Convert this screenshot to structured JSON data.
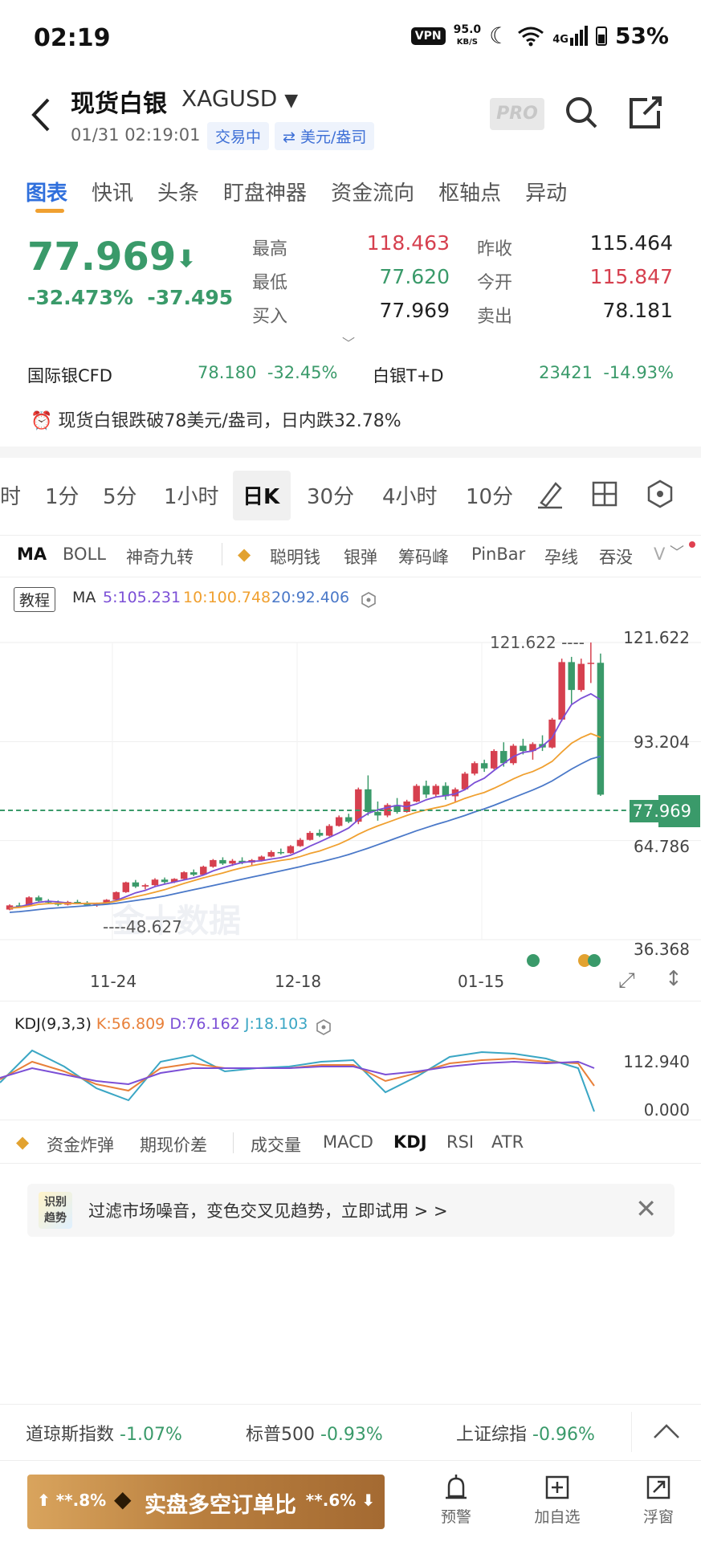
{
  "status_bar": {
    "time": "02:19",
    "vpn": "VPN",
    "speed_value": "95.0",
    "speed_unit": "KB/S",
    "network": "4G",
    "battery": "53%"
  },
  "header": {
    "title": "现货白银",
    "symbol": "XAGUSD",
    "datetime": "01/31 02:19:01",
    "trading_status": "交易中",
    "unit": "⇄ 美元/盎司",
    "pro_label": "PRO"
  },
  "tabs": [
    {
      "label": "图表",
      "active": true
    },
    {
      "label": "快讯"
    },
    {
      "label": "头条"
    },
    {
      "label": "盯盘神器"
    },
    {
      "label": "资金流向"
    },
    {
      "label": "枢轴点"
    },
    {
      "label": "异动"
    }
  ],
  "quote": {
    "price": "77.969",
    "arrow": "⬇",
    "change_pct": "-32.473%",
    "change_abs": "-37.495",
    "high_label": "最高",
    "high": "118.463",
    "low_label": "最低",
    "low": "77.620",
    "bid_label": "买入",
    "bid": "77.969",
    "prev_close_label": "昨收",
    "prev_close": "115.464",
    "open_label": "今开",
    "open": "115.847",
    "ask_label": "卖出",
    "ask": "78.181"
  },
  "related": [
    {
      "name": "国际银CFD",
      "price": "78.180",
      "change": "-32.45%"
    },
    {
      "name": "白银T+D",
      "price": "23421",
      "change": "-14.93%"
    }
  ],
  "alert_text": "现货白银跌破78美元/盎司，日内跌32.78%",
  "timeframes": [
    "时",
    "1分",
    "5分",
    "1小时",
    "日K",
    "30分",
    "4小时",
    "10分"
  ],
  "active_timeframe": "日K",
  "indicators": [
    "MA",
    "BOLL",
    "神奇九转",
    "聪明钱",
    "银弹",
    "筹码峰",
    "PinBar",
    "孕线",
    "吞没",
    "V"
  ],
  "ma_legend": {
    "tutorial": "教程",
    "label": "MA",
    "ma5": "5:105.231",
    "ma10": "10:100.748",
    "ma20": "20:92.406"
  },
  "chart_axis": {
    "y_labels": [
      "121.622",
      "93.204",
      "64.786",
      "36.368"
    ],
    "current": "77.969",
    "high_marker": "121.622 ----",
    "low_marker": "----48.627",
    "x_labels": [
      "11-24",
      "12-18",
      "01-15"
    ],
    "watermark": "金十数据"
  },
  "chart_data": {
    "type": "candlestick",
    "ylim": [
      36.368,
      121.622
    ],
    "candles": [
      [
        45.0,
        46.5,
        44.8,
        46.2
      ],
      [
        46.2,
        47.0,
        45.6,
        46.0
      ],
      [
        46.0,
        48.8,
        45.8,
        48.5
      ],
      [
        48.5,
        49.0,
        47.2,
        47.5
      ],
      [
        47.5,
        48.0,
        46.6,
        47.0
      ],
      [
        47.0,
        47.6,
        46.0,
        46.4
      ],
      [
        46.4,
        47.5,
        46.2,
        47.2
      ],
      [
        47.2,
        47.8,
        46.5,
        46.9
      ],
      [
        46.9,
        47.4,
        46.0,
        46.3
      ],
      [
        46.3,
        47.0,
        45.8,
        46.6
      ],
      [
        46.6,
        48.0,
        46.4,
        47.8
      ],
      [
        47.8,
        50.2,
        47.5,
        50.0
      ],
      [
        50.0,
        53.0,
        49.8,
        52.8
      ],
      [
        52.8,
        53.5,
        51.2,
        51.6
      ],
      [
        51.6,
        52.4,
        50.8,
        52.0
      ],
      [
        52.0,
        54.0,
        51.8,
        53.6
      ],
      [
        53.6,
        54.2,
        52.5,
        52.9
      ],
      [
        52.9,
        54.0,
        52.6,
        53.8
      ],
      [
        53.8,
        56.0,
        53.5,
        55.7
      ],
      [
        55.7,
        56.5,
        54.6,
        55.0
      ],
      [
        55.0,
        57.6,
        54.8,
        57.3
      ],
      [
        57.3,
        59.5,
        57.0,
        59.2
      ],
      [
        59.2,
        60.0,
        57.8,
        58.2
      ],
      [
        58.2,
        59.5,
        57.5,
        59.0
      ],
      [
        59.0,
        60.0,
        58.0,
        58.5
      ],
      [
        58.5,
        59.5,
        57.8,
        59.2
      ],
      [
        59.2,
        60.5,
        58.8,
        60.2
      ],
      [
        60.2,
        62.0,
        60.0,
        61.5
      ],
      [
        61.5,
        62.5,
        60.8,
        61.2
      ],
      [
        61.2,
        63.5,
        61.0,
        63.2
      ],
      [
        63.2,
        65.5,
        63.0,
        65.0
      ],
      [
        65.0,
        67.5,
        64.8,
        67.0
      ],
      [
        67.0,
        68.0,
        65.8,
        66.2
      ],
      [
        66.2,
        69.5,
        66.0,
        69.0
      ],
      [
        69.0,
        72.0,
        68.8,
        71.5
      ],
      [
        71.5,
        72.5,
        69.8,
        70.2
      ],
      [
        70.2,
        80.0,
        69.5,
        79.5
      ],
      [
        79.5,
        83.5,
        72.0,
        73.0
      ],
      [
        73.0,
        76.0,
        70.5,
        72.0
      ],
      [
        72.0,
        75.5,
        71.5,
        75.0
      ],
      [
        75.0,
        77.0,
        72.5,
        73.0
      ],
      [
        73.0,
        76.5,
        72.8,
        76.0
      ],
      [
        76.0,
        81.0,
        75.8,
        80.5
      ],
      [
        80.5,
        82.0,
        77.0,
        78.0
      ],
      [
        78.0,
        81.0,
        77.5,
        80.5
      ],
      [
        80.5,
        81.5,
        76.5,
        77.5
      ],
      [
        77.5,
        80.0,
        76.0,
        79.5
      ],
      [
        79.5,
        84.5,
        79.2,
        84.0
      ],
      [
        84.0,
        87.5,
        83.5,
        87.0
      ],
      [
        87.0,
        88.0,
        84.5,
        85.5
      ],
      [
        85.5,
        91.0,
        85.2,
        90.5
      ],
      [
        90.5,
        93.0,
        86.0,
        87.0
      ],
      [
        87.0,
        92.5,
        86.5,
        92.0
      ],
      [
        92.0,
        94.0,
        89.5,
        90.5
      ],
      [
        90.5,
        93.0,
        88.0,
        92.5
      ],
      [
        92.5,
        95.0,
        90.5,
        91.5
      ],
      [
        91.5,
        100.0,
        91.2,
        99.5
      ],
      [
        99.5,
        117.0,
        99.0,
        116.0
      ],
      [
        116.0,
        117.5,
        104.0,
        108.0
      ],
      [
        108.0,
        117.0,
        107.5,
        115.5
      ],
      [
        115.5,
        121.622,
        110.0,
        115.8
      ],
      [
        115.8,
        118.463,
        77.62,
        77.969
      ]
    ],
    "ma": [
      {
        "name": "MA 5",
        "color": "#7b4fd6",
        "values": [
          45.5,
          45.8,
          46.5,
          47.1,
          47.4,
          47.2,
          46.9,
          46.7,
          46.8,
          46.7,
          46.9,
          47.6,
          48.7,
          49.8,
          50.5,
          51.6,
          52.3,
          52.9,
          53.5,
          54.1,
          54.9,
          56.1,
          57.0,
          57.8,
          58.5,
          58.8,
          59.0,
          59.5,
          59.9,
          60.6,
          61.8,
          63.2,
          64.4,
          65.7,
          67.0,
          68.4,
          70.8,
          72.6,
          73.6,
          74.3,
          74.9,
          74.5,
          75.3,
          76.5,
          77.3,
          77.7,
          78.2,
          79.4,
          81.4,
          82.7,
          84.9,
          86.9,
          88.9,
          90.1,
          90.5,
          91.9,
          94.3,
          99.4,
          103.8,
          105.6,
          106.9,
          105.2
        ]
      },
      {
        "name": "MA 10",
        "color": "#f0a030",
        "values": [
          45.4,
          45.6,
          46.0,
          46.5,
          46.7,
          46.8,
          46.8,
          46.7,
          46.8,
          46.8,
          46.9,
          47.4,
          48.1,
          48.7,
          49.3,
          50.0,
          50.7,
          51.6,
          52.5,
          53.3,
          54.1,
          54.8,
          55.5,
          56.3,
          57.0,
          57.6,
          58.1,
          58.6,
          59.1,
          59.5,
          60.2,
          61.1,
          61.8,
          62.8,
          63.8,
          65.1,
          66.6,
          67.9,
          69.0,
          70.0,
          71.0,
          72.0,
          72.9,
          73.6,
          74.2,
          74.8,
          75.8,
          76.9,
          77.8,
          78.6,
          79.8,
          81.1,
          82.5,
          83.7,
          84.6,
          85.9,
          87.5,
          90.2,
          92.7,
          94.3,
          95.5,
          94.4
        ]
      },
      {
        "name": "MA 20",
        "color": "#4a78c8",
        "values": [
          44.2,
          44.4,
          44.7,
          45.0,
          45.3,
          45.5,
          45.7,
          45.9,
          46.1,
          46.3,
          46.5,
          46.8,
          47.2,
          47.6,
          48.0,
          48.4,
          48.9,
          49.5,
          50.1,
          50.7,
          51.3,
          51.9,
          52.5,
          53.1,
          53.7,
          54.3,
          54.9,
          55.5,
          56.1,
          56.7,
          57.3,
          58.0,
          58.6,
          59.3,
          60.0,
          60.8,
          61.7,
          62.6,
          63.6,
          64.6,
          65.6,
          66.6,
          67.6,
          68.5,
          69.4,
          70.2,
          71.1,
          72.0,
          73.0,
          73.9,
          74.9,
          76.0,
          77.1,
          78.2,
          79.3,
          80.5,
          81.9,
          83.6,
          85.3,
          86.8,
          88.2,
          89.0
        ]
      }
    ]
  },
  "kdj": {
    "label": "KDJ(9,3,3)",
    "k": "K:56.809",
    "d": "D:76.162",
    "j": "J:18.103",
    "y_top": "112.940",
    "y_bottom": "0.000"
  },
  "bottom_indicators": [
    "资金炸弹",
    "期现价差",
    "成交量",
    "MACD",
    "KDJ",
    "RSI",
    "ATR"
  ],
  "promo": {
    "badge_line1": "识别",
    "badge_line2": "趋势",
    "text": "过滤市场噪音，变色交叉见趋势，立即试用 > >"
  },
  "markets": [
    {
      "name": "道琼斯指数",
      "change": "-1.07%"
    },
    {
      "name": "标普500",
      "change": "-0.93%"
    },
    {
      "name": "上证综指",
      "change": "-0.96%"
    }
  ],
  "bottom_bar": {
    "left_pct": "⬆ **.8%",
    "cta": "实盘多空订单比",
    "right_pct": "**.6% ⬇",
    "alert": "预警",
    "add": "加自选",
    "float": "浮窗"
  }
}
